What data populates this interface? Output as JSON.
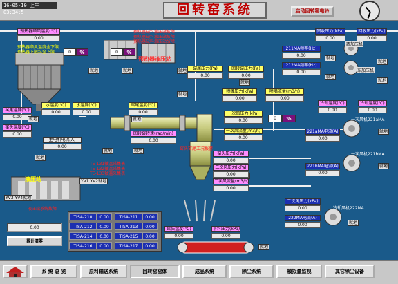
{
  "header": {
    "date": "16-05-10 上午 03:34:5",
    "title": "回转窑系统",
    "start_button": "启动回转窑电铃"
  },
  "labels": {
    "fan_top": "预热器顺风温度(℃)",
    "fan_top_v": "0.00",
    "preheater_alarm_1": "预热器顺风温度全下限",
    "preheater_alarm_2": "预热器下限料全下限",
    "cyc_pct": "0",
    "cyc_pct_unit": "%",
    "cyc_pct2": "0",
    "cyc_pct2_unit": "%",
    "preheater_ctrl": "预热器液压站",
    "red1": "预热器缺料液压站故障",
    "red2": "预热器缺料液压站故障",
    "red3": "预热器缺料液压站故障",
    "f211_freq": "211MA频率(Hz)",
    "f211_v": "0.00",
    "f212_freq": "212MA频率(Hz)",
    "f212_v": "0.00",
    "tail_temp": "窑尾温度(℃)",
    "tail_temp_v": "0.00",
    "tail_press": "窑尾压力(Pa)",
    "tail_press_v": "0.00",
    "inlet_temp": "窑尾温度(℃)",
    "inlet_temp_v": "0.00",
    "inlet_press": "回转窑压力(Pa)",
    "inlet_press_v": "0.00",
    "coal_press": "喷嘴压力(kPa)",
    "coal_press_v": "0.00",
    "coal_flow": "喷嘴流量(m3/h)",
    "coal_flow_v": "0.00",
    "temp1": "水温度(℃)",
    "temp1_v": "0.00",
    "temp2": "水温度(℃)",
    "temp2_v": "0.00",
    "motor_curr": "主电机电流(A)",
    "motor_curr_v": "0.00",
    "kiln_speed": "回转窑转速(rad/min)",
    "kiln_speed_v": "0.00",
    "red_kiln": "窑头窑尾工况报警",
    "red_a": "TE-131轴温采集表",
    "red_b": "TE-132轴温采集表",
    "red_c": "TE-133轴温采集表",
    "hydraulic": "液压站",
    "red_hyd": "液压站系统故障",
    "prim_press": "一次风压力(kPa)",
    "prim_press_v": "0.00",
    "prim_flow": "一次风流量(m3/h)",
    "prim_flow_v": "0.00",
    "sec_press": "二次风压力(kPa)",
    "sec_press_v": "0.00",
    "sec_flow": "二次风流量(m3/h)",
    "sec_flow_v": "0.00",
    "kilnhead_temp": "窑头温度(℃)",
    "kilnhead_temp_v": "0.00",
    "kilnhead_press": "窑头压力(kPa)",
    "kilnhead_press_v": "0.00",
    "pct3": "0",
    "pct3_unit": "%",
    "fan221_curr": "221aMA电流(A)",
    "fan221_curr_v": "0.00",
    "fan221b_curr": "221bMA电流(A)",
    "fan221b_curr_v": "0.00",
    "cool_press": "二次风压力(kPa)",
    "cool_press_v": "0.00",
    "cool222_curr": "222MA电流(A)",
    "cool222_curr_v": "0.00",
    "outlet_temp": "窑头温度(℃)",
    "outlet_temp_v": "0.00",
    "bottom_temp": "下料温度(℃)",
    "bottom_temp_v": "0.00",
    "cool_temp": "下料压力(kPa)",
    "cool_temp_v": "0.00",
    "r_press1": "回收压力(kPa)",
    "r_press1_v": "0.00",
    "r_press2": "回收压力(kPa)",
    "r_press2_v": "0.00",
    "r_temp1": "冷却温度(℃)",
    "r_temp1_v": "0.00",
    "r_temp2": "冷却温度(℃)",
    "r_temp2_v": "0.00",
    "west_comp": "西加压机",
    "east_comp": "东加压机",
    "fan221a": "一次风机221aMA",
    "fan221b": "一次风机221bMA",
    "fan222": "冷却风机222MA",
    "yv": "YV3 YV4就地",
    "yv2": "YV1 YV2就地",
    "total_v": "0.00",
    "reset_btn": "累计清零",
    "local": "就地"
  },
  "tisa": [
    {
      "name": "TISA-210",
      "val": "0.00",
      "name2": "TISA-211",
      "val2": "0.00"
    },
    {
      "name": "TISA-212",
      "val": "0.00",
      "name2": "TISA-213",
      "val2": "0.00"
    },
    {
      "name": "TISA-214",
      "val": "0.00",
      "name2": "TISA-215",
      "val2": "0.00"
    },
    {
      "name": "TISA-216",
      "val": "0.00",
      "name2": "TISA-217",
      "val2": "0.00"
    }
  ],
  "nav": [
    "系 统 总 览",
    "原料输送系统",
    "回转窑窑体",
    "成品系统",
    "除尘系统",
    "模拟量监视",
    "其它除尘设备"
  ]
}
